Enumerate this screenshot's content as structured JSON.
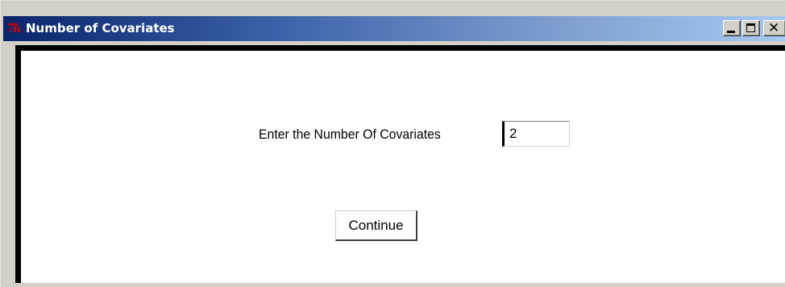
{
  "window": {
    "title": "Number of Covariates",
    "icon": "tk-feather-icon",
    "controls": {
      "minimize": "minimize-icon",
      "maximize": "maximize-icon",
      "close": "close-icon"
    },
    "titlebar_color_start": "#0a246a",
    "titlebar_color_end": "#a6caf0"
  },
  "form": {
    "prompt_label": "Enter the Number Of Covariates",
    "count_value": "2",
    "continue_label": "Continue"
  }
}
